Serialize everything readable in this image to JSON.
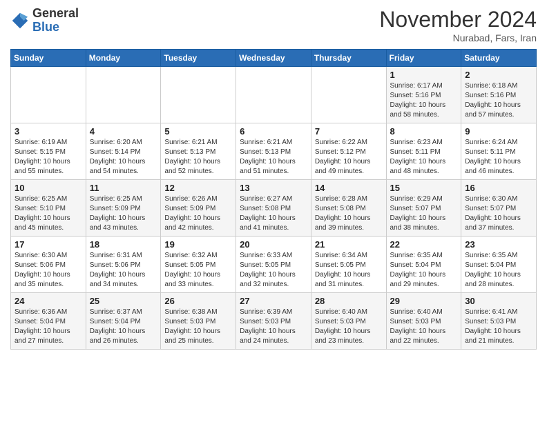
{
  "logo": {
    "general": "General",
    "blue": "Blue"
  },
  "header": {
    "month": "November 2024",
    "location": "Nurabad, Fars, Iran"
  },
  "days_of_week": [
    "Sunday",
    "Monday",
    "Tuesday",
    "Wednesday",
    "Thursday",
    "Friday",
    "Saturday"
  ],
  "weeks": [
    [
      {
        "day": "",
        "info": ""
      },
      {
        "day": "",
        "info": ""
      },
      {
        "day": "",
        "info": ""
      },
      {
        "day": "",
        "info": ""
      },
      {
        "day": "",
        "info": ""
      },
      {
        "day": "1",
        "info": "Sunrise: 6:17 AM\nSunset: 5:16 PM\nDaylight: 10 hours\nand 58 minutes."
      },
      {
        "day": "2",
        "info": "Sunrise: 6:18 AM\nSunset: 5:16 PM\nDaylight: 10 hours\nand 57 minutes."
      }
    ],
    [
      {
        "day": "3",
        "info": "Sunrise: 6:19 AM\nSunset: 5:15 PM\nDaylight: 10 hours\nand 55 minutes."
      },
      {
        "day": "4",
        "info": "Sunrise: 6:20 AM\nSunset: 5:14 PM\nDaylight: 10 hours\nand 54 minutes."
      },
      {
        "day": "5",
        "info": "Sunrise: 6:21 AM\nSunset: 5:13 PM\nDaylight: 10 hours\nand 52 minutes."
      },
      {
        "day": "6",
        "info": "Sunrise: 6:21 AM\nSunset: 5:13 PM\nDaylight: 10 hours\nand 51 minutes."
      },
      {
        "day": "7",
        "info": "Sunrise: 6:22 AM\nSunset: 5:12 PM\nDaylight: 10 hours\nand 49 minutes."
      },
      {
        "day": "8",
        "info": "Sunrise: 6:23 AM\nSunset: 5:11 PM\nDaylight: 10 hours\nand 48 minutes."
      },
      {
        "day": "9",
        "info": "Sunrise: 6:24 AM\nSunset: 5:11 PM\nDaylight: 10 hours\nand 46 minutes."
      }
    ],
    [
      {
        "day": "10",
        "info": "Sunrise: 6:25 AM\nSunset: 5:10 PM\nDaylight: 10 hours\nand 45 minutes."
      },
      {
        "day": "11",
        "info": "Sunrise: 6:25 AM\nSunset: 5:09 PM\nDaylight: 10 hours\nand 43 minutes."
      },
      {
        "day": "12",
        "info": "Sunrise: 6:26 AM\nSunset: 5:09 PM\nDaylight: 10 hours\nand 42 minutes."
      },
      {
        "day": "13",
        "info": "Sunrise: 6:27 AM\nSunset: 5:08 PM\nDaylight: 10 hours\nand 41 minutes."
      },
      {
        "day": "14",
        "info": "Sunrise: 6:28 AM\nSunset: 5:08 PM\nDaylight: 10 hours\nand 39 minutes."
      },
      {
        "day": "15",
        "info": "Sunrise: 6:29 AM\nSunset: 5:07 PM\nDaylight: 10 hours\nand 38 minutes."
      },
      {
        "day": "16",
        "info": "Sunrise: 6:30 AM\nSunset: 5:07 PM\nDaylight: 10 hours\nand 37 minutes."
      }
    ],
    [
      {
        "day": "17",
        "info": "Sunrise: 6:30 AM\nSunset: 5:06 PM\nDaylight: 10 hours\nand 35 minutes."
      },
      {
        "day": "18",
        "info": "Sunrise: 6:31 AM\nSunset: 5:06 PM\nDaylight: 10 hours\nand 34 minutes."
      },
      {
        "day": "19",
        "info": "Sunrise: 6:32 AM\nSunset: 5:05 PM\nDaylight: 10 hours\nand 33 minutes."
      },
      {
        "day": "20",
        "info": "Sunrise: 6:33 AM\nSunset: 5:05 PM\nDaylight: 10 hours\nand 32 minutes."
      },
      {
        "day": "21",
        "info": "Sunrise: 6:34 AM\nSunset: 5:05 PM\nDaylight: 10 hours\nand 31 minutes."
      },
      {
        "day": "22",
        "info": "Sunrise: 6:35 AM\nSunset: 5:04 PM\nDaylight: 10 hours\nand 29 minutes."
      },
      {
        "day": "23",
        "info": "Sunrise: 6:35 AM\nSunset: 5:04 PM\nDaylight: 10 hours\nand 28 minutes."
      }
    ],
    [
      {
        "day": "24",
        "info": "Sunrise: 6:36 AM\nSunset: 5:04 PM\nDaylight: 10 hours\nand 27 minutes."
      },
      {
        "day": "25",
        "info": "Sunrise: 6:37 AM\nSunset: 5:04 PM\nDaylight: 10 hours\nand 26 minutes."
      },
      {
        "day": "26",
        "info": "Sunrise: 6:38 AM\nSunset: 5:03 PM\nDaylight: 10 hours\nand 25 minutes."
      },
      {
        "day": "27",
        "info": "Sunrise: 6:39 AM\nSunset: 5:03 PM\nDaylight: 10 hours\nand 24 minutes."
      },
      {
        "day": "28",
        "info": "Sunrise: 6:40 AM\nSunset: 5:03 PM\nDaylight: 10 hours\nand 23 minutes."
      },
      {
        "day": "29",
        "info": "Sunrise: 6:40 AM\nSunset: 5:03 PM\nDaylight: 10 hours\nand 22 minutes."
      },
      {
        "day": "30",
        "info": "Sunrise: 6:41 AM\nSunset: 5:03 PM\nDaylight: 10 hours\nand 21 minutes."
      }
    ]
  ]
}
